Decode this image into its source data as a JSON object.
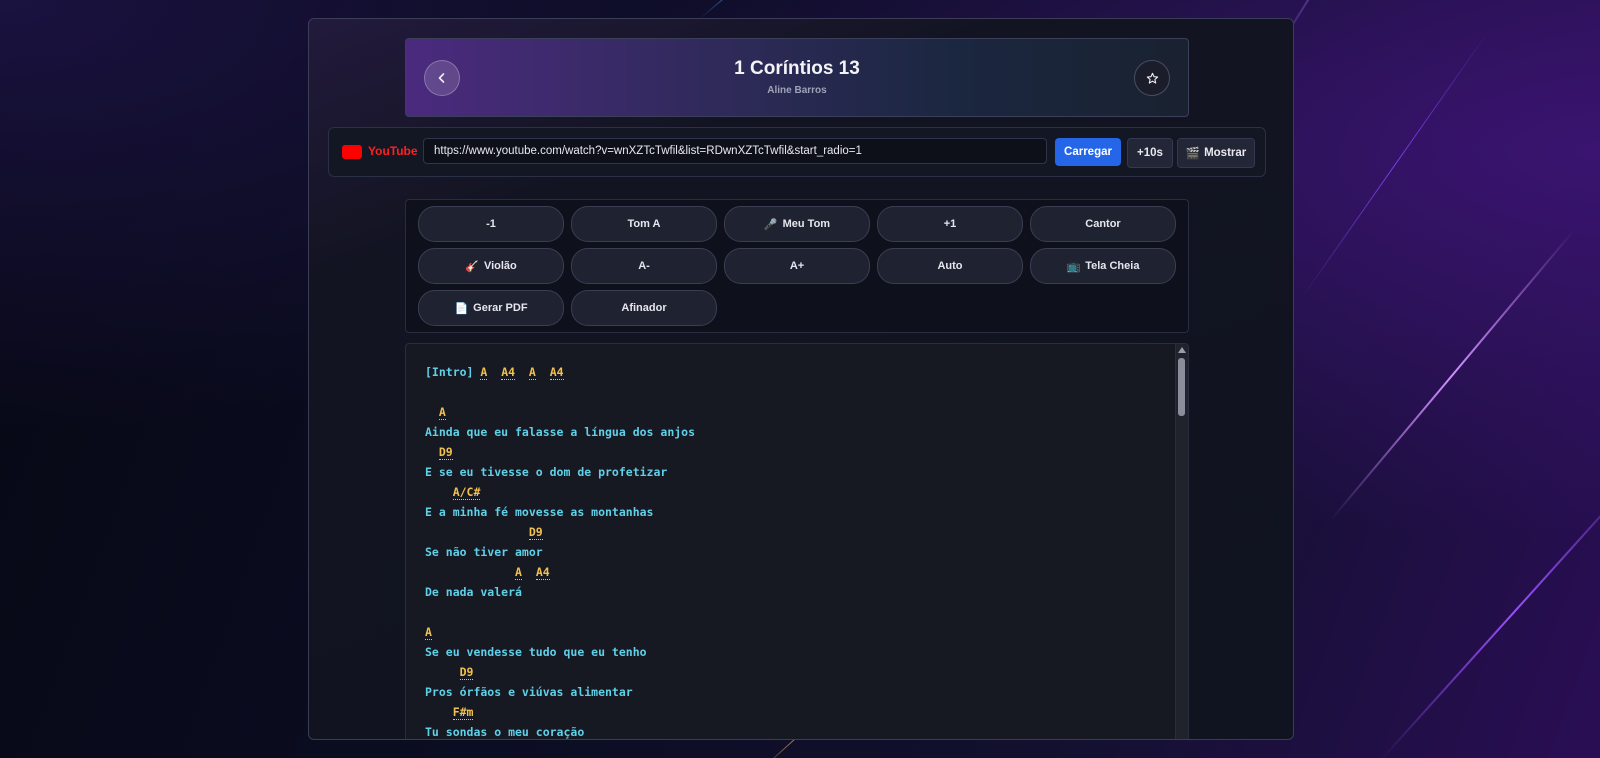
{
  "header": {
    "title": "1 Coríntios 13",
    "artist": "Aline Barros",
    "back_icon": "chevron-left-icon",
    "favorite_icon": "star-icon"
  },
  "youtube": {
    "brand": "YouTube",
    "url": "https://www.youtube.com/watch?v=wnXZTcTwfil&list=RDwnXZTcTwfil&start_radio=1",
    "load_label": "Carregar",
    "skip_label": "+10s",
    "show_label": "Mostrar",
    "show_icon": "clapper-icon"
  },
  "controls": [
    {
      "label": "-1",
      "icon": ""
    },
    {
      "label": "Tom A",
      "icon": ""
    },
    {
      "label": "Meu Tom",
      "icon": "🎤"
    },
    {
      "label": "+1",
      "icon": ""
    },
    {
      "label": "Cantor",
      "icon": ""
    },
    {
      "label": "Violão",
      "icon": "🎸"
    },
    {
      "label": "A-",
      "icon": ""
    },
    {
      "label": "A+",
      "icon": ""
    },
    {
      "label": "Auto",
      "icon": ""
    },
    {
      "label": "Tela Cheia",
      "icon": "📺"
    },
    {
      "label": "Gerar PDF",
      "icon": "📄"
    },
    {
      "label": "Afinador",
      "icon": ""
    }
  ],
  "song": {
    "intro_tag": "[Intro]",
    "intro_chords": [
      "A",
      "A4",
      "A",
      "A4"
    ],
    "lines": [
      {
        "type": "blank",
        "text": ""
      },
      {
        "type": "chords",
        "text": "  A"
      },
      {
        "type": "lyric",
        "text": "Ainda que eu falasse a língua dos anjos"
      },
      {
        "type": "chords",
        "text": "  D9"
      },
      {
        "type": "lyric",
        "text": "E se eu tivesse o dom de profetizar"
      },
      {
        "type": "chords",
        "text": "    A/C#"
      },
      {
        "type": "lyric",
        "text": "E a minha fé movesse as montanhas"
      },
      {
        "type": "chords",
        "text": "               D9"
      },
      {
        "type": "lyric",
        "text": "Se não tiver amor"
      },
      {
        "type": "chords",
        "text": "             A  A4"
      },
      {
        "type": "lyric",
        "text": "De nada valerá"
      },
      {
        "type": "blank",
        "text": ""
      },
      {
        "type": "chords",
        "text": "A"
      },
      {
        "type": "lyric",
        "text": "Se eu vendesse tudo que eu tenho"
      },
      {
        "type": "chords",
        "text": "     D9"
      },
      {
        "type": "lyric",
        "text": "Pros órfãos e viúvas alimentar"
      },
      {
        "type": "chords",
        "text": "    F#m"
      },
      {
        "type": "lyric",
        "text": "Tu sondas o meu coração"
      }
    ]
  }
}
